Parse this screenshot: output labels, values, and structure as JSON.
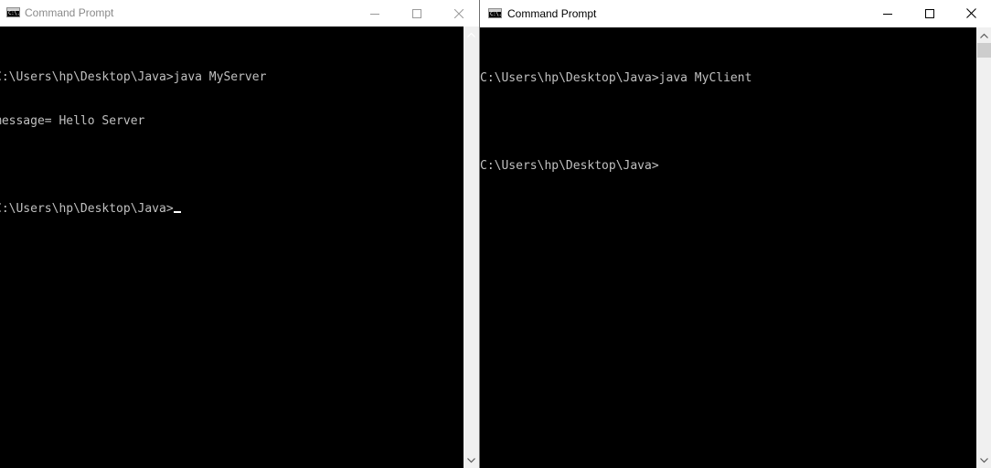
{
  "left_window": {
    "title": "Command Prompt",
    "icon": "console-app-icon",
    "icon_glyph": "C:\\.",
    "caption_buttons": [
      "minimize",
      "maximize",
      "close"
    ],
    "lines": [
      "C:\\Users\\hp\\Desktop\\Java>java MyServer",
      "message= Hello Server",
      "",
      "C:\\Users\\hp\\Desktop\\Java>"
    ],
    "cursor_visible": true,
    "active": false
  },
  "right_window": {
    "title": "Command Prompt",
    "icon": "console-app-icon",
    "icon_glyph": "C:\\.",
    "caption_buttons": [
      "minimize",
      "maximize",
      "close"
    ],
    "lines": [
      "C:\\Users\\hp\\Desktop\\Java>java MyClient",
      "",
      "C:\\Users\\hp\\Desktop\\Java>"
    ],
    "active": true
  },
  "colors": {
    "console_background": "#000000",
    "console_text": "#c0c0c0",
    "inactive_title_text": "#8a8a8a",
    "active_title_text": "#000000"
  }
}
